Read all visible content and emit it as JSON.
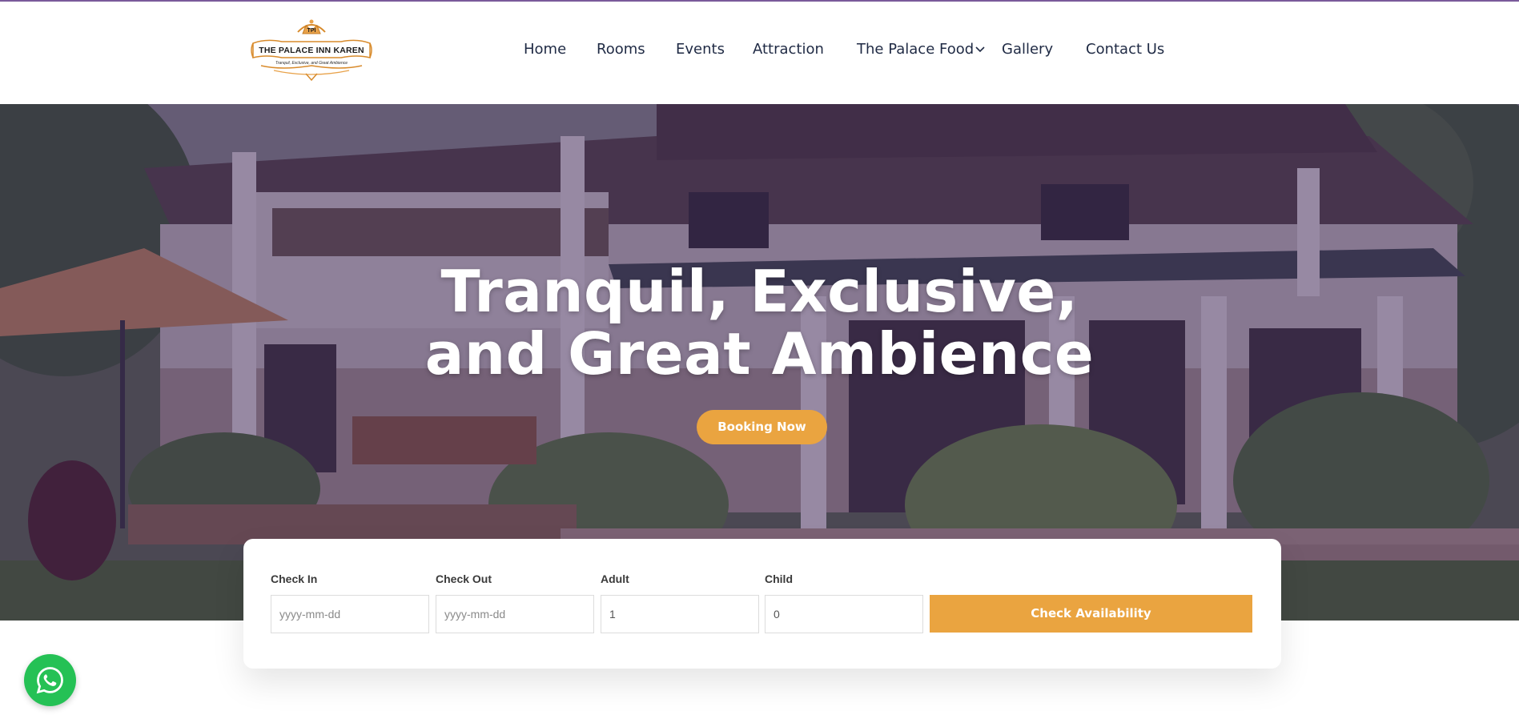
{
  "logo": {
    "monogram": "TPI",
    "title": "THE PALACE INN KAREN",
    "tagline": "Tranquil, Exclusive, and Great Ambience"
  },
  "nav": {
    "items": [
      {
        "label": "Home"
      },
      {
        "label": "Rooms"
      },
      {
        "label": "Events"
      },
      {
        "label": "Attraction"
      },
      {
        "label": "The Palace Food",
        "has_dropdown": true
      },
      {
        "label": "Gallery"
      },
      {
        "label": "Contact Us"
      }
    ]
  },
  "hero": {
    "title_line1": "Tranquil, Exclusive,",
    "title_line2": "and Great Ambience",
    "button_label": "Booking Now"
  },
  "booking_form": {
    "check_in": {
      "label": "Check In",
      "placeholder": "yyyy-mm-dd",
      "value": ""
    },
    "check_out": {
      "label": "Check Out",
      "placeholder": "yyyy-mm-dd",
      "value": ""
    },
    "adult": {
      "label": "Adult",
      "value": "1"
    },
    "child": {
      "label": "Child",
      "value": "0"
    },
    "submit_label": "Check Availability"
  },
  "icons": {
    "whatsapp": "whatsapp-icon",
    "dropdown": "chevron-down-icon"
  },
  "colors": {
    "accent": "#eaa440",
    "nav_text": "#1f2a44",
    "hero_overlay": "#371e5f",
    "whatsapp": "#25c155"
  }
}
